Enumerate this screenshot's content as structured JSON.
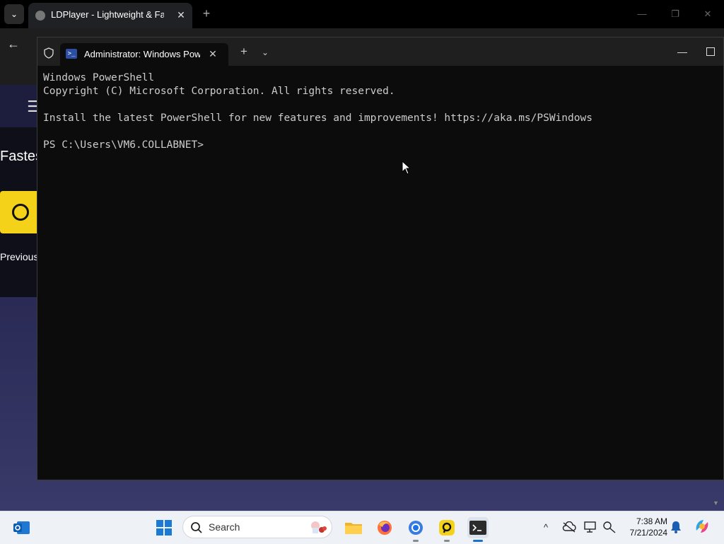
{
  "browser": {
    "tab_title": "LDPlayer - Lightweight & Fast",
    "tab_close": "✕",
    "new_tab": "+",
    "page_heading": "Fastes",
    "previous_label": "Previous"
  },
  "terminal": {
    "tab_title": "Administrator: Windows Powe",
    "tab_close": "✕",
    "new_tab": "+",
    "dropdown": "⌄",
    "minimize": "—",
    "lines": [
      "Windows PowerShell",
      "Copyright (C) Microsoft Corporation. All rights reserved.",
      "",
      "Install the latest PowerShell for new features and improvements! https://aka.ms/PSWindows",
      "",
      "PS C:\\Users\\VM6.COLLABNET>"
    ]
  },
  "taskbar": {
    "search_placeholder": "Search",
    "clock_time": "7:38 AM",
    "clock_date": "7/21/2024",
    "tray_chevron": "^"
  },
  "colors": {
    "terminal_bg": "#0c0c0c",
    "terminal_text": "#cccccc",
    "taskbar_bg": "#eef1f6",
    "accent": "#1a73c8",
    "ldplayer_yellow": "#f5d21a"
  }
}
